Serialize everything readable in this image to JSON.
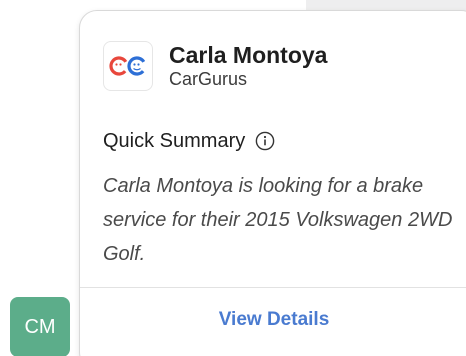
{
  "card": {
    "name": "Carla Montoya",
    "company": "CarGurus",
    "summary_title": "Quick Summary",
    "summary_text": "Carla Montoya is looking for a brake service for their 2015 Volkswagen 2WD Golf.",
    "view_details_label": "View Details"
  },
  "avatar": {
    "initials": "CM"
  },
  "icons": {
    "logo": "cargurus-logo-icon",
    "info": "info-icon"
  },
  "colors": {
    "link": "#4a7bd0",
    "avatar_bg": "#5cad8a",
    "logo_red": "#e8473c",
    "logo_blue": "#2d6fd6"
  }
}
